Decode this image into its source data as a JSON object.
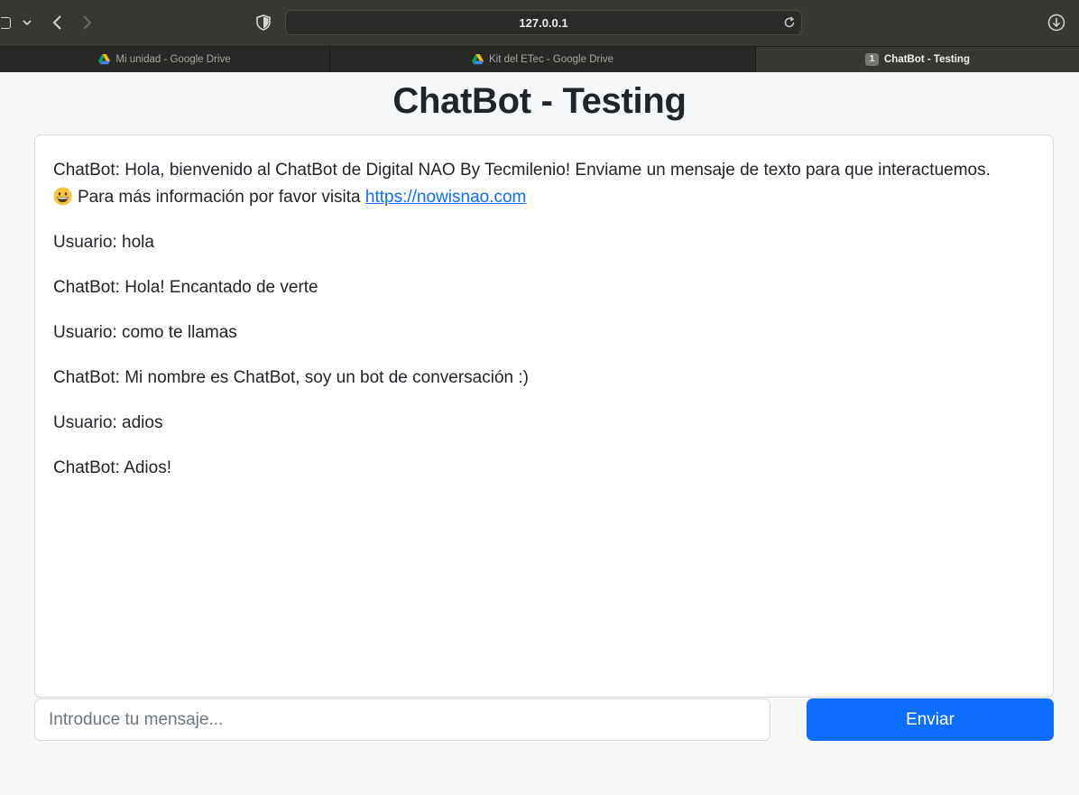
{
  "browser": {
    "url": "127.0.0.1",
    "tabs": [
      {
        "label": "Mi unidad - Google Drive",
        "icon": "google-drive-icon",
        "active": false
      },
      {
        "label": "Kit del ETec - Google Drive",
        "icon": "google-drive-icon",
        "active": false
      },
      {
        "label": "ChatBot - Testing",
        "badge": "1",
        "active": true
      }
    ]
  },
  "page": {
    "title": "ChatBot - Testing",
    "messages": [
      {
        "text": "ChatBot: Hola, bienvenido al ChatBot de Digital NAO By Tecmilenio! Enviame un mensaje de texto para que interactuemos."
      },
      {
        "emoji": "😄",
        "text": "Para más información por favor visita",
        "link": "https://nowisnao.com"
      },
      {
        "text": "Usuario: hola"
      },
      {
        "text": "ChatBot: Hola! Encantado de verte"
      },
      {
        "text": "Usuario: como te llamas"
      },
      {
        "text": "ChatBot: Mi nombre es ChatBot, soy un bot de conversación :)"
      },
      {
        "text": "Usuario: adios"
      },
      {
        "text": "ChatBot: Adios!"
      }
    ],
    "input_placeholder": "Introduce tu mensaje...",
    "send_label": "Enviar"
  },
  "colors": {
    "primary": "#0d6efd",
    "text": "#212529",
    "background": "#f6f7f9",
    "chrome": "#383734"
  }
}
